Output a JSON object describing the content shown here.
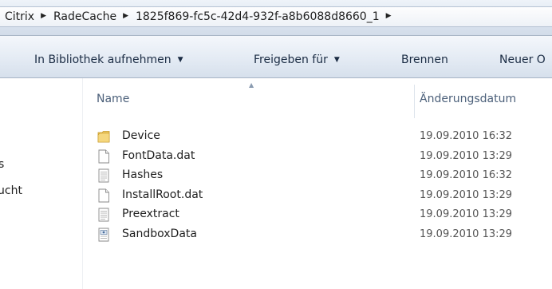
{
  "breadcrumb": {
    "items": [
      "Citrix",
      "RadeCache",
      "1825f869-fc5c-42d4-932f-a8b6088d8660_1"
    ]
  },
  "toolbar": {
    "library_label": "In Bibliothek aufnehmen",
    "share_label": "Freigeben für",
    "burn_label": "Brennen",
    "new_folder_label": "Neuer O"
  },
  "navigation": {
    "items": [
      "s",
      "ucht"
    ]
  },
  "columns": {
    "name": "Name",
    "modified": "Änderungsdatum"
  },
  "files": [
    {
      "name": "Device",
      "date": "19.09.2010 16:32",
      "icon": "folder-icon"
    },
    {
      "name": "FontData.dat",
      "date": "19.09.2010 13:29",
      "icon": "blank-file-icon"
    },
    {
      "name": "Hashes",
      "date": "19.09.2010 16:32",
      "icon": "text-file-icon"
    },
    {
      "name": "InstallRoot.dat",
      "date": "19.09.2010 13:29",
      "icon": "blank-file-icon"
    },
    {
      "name": "Preextract",
      "date": "19.09.2010 13:29",
      "icon": "text-file-icon"
    },
    {
      "name": "SandboxData",
      "date": "19.09.2010 13:29",
      "icon": "config-file-icon"
    }
  ],
  "colors": {
    "toolbar_text": "#1b2c44",
    "header_text": "#4c607a",
    "folder": "#e9c25a"
  }
}
